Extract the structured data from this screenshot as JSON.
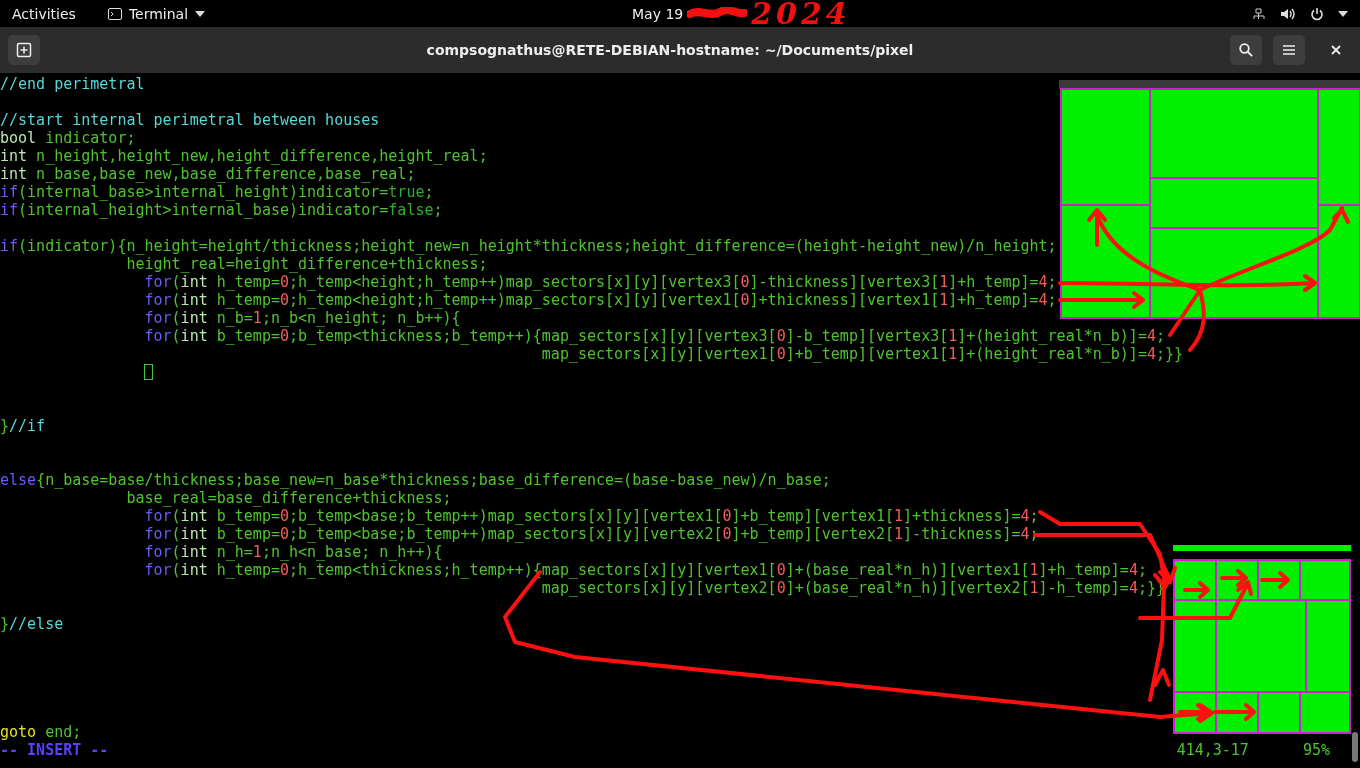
{
  "top_bar": {
    "activities": "Activities",
    "app_menu": "Terminal",
    "date": "May 19",
    "handwritten_year": "2024"
  },
  "window": {
    "title": "compsognathus@RETE-DEBIAN-hostname: ~/Documents/pixel"
  },
  "editor": {
    "lines": [
      {
        "kind": "code",
        "segments": [
          {
            "kind": "comment",
            "text": "//end perimetral"
          }
        ]
      },
      {
        "kind": "blank"
      },
      {
        "kind": "code",
        "segments": [
          {
            "kind": "comment",
            "text": "//start internal perimetral between houses"
          }
        ]
      },
      {
        "kind": "code",
        "segments": [
          {
            "kind": "type",
            "text": "bool"
          },
          {
            "kind": "plain",
            "text": " indicator;"
          }
        ]
      },
      {
        "kind": "code",
        "segments": [
          {
            "kind": "type",
            "text": "int"
          },
          {
            "kind": "plain",
            "text": " n_height,height_new,height_difference,height_real;"
          }
        ]
      },
      {
        "kind": "code",
        "segments": [
          {
            "kind": "type",
            "text": "int"
          },
          {
            "kind": "plain",
            "text": " n_base,base_new,base_difference,base_real;"
          }
        ]
      },
      {
        "kind": "code",
        "segments": [
          {
            "kind": "keyword",
            "text": "if"
          },
          {
            "kind": "plain",
            "text": "(internal_base>internal_height)indicator="
          },
          {
            "kind": "constant",
            "text": "true"
          },
          {
            "kind": "plain",
            "text": ";"
          }
        ]
      },
      {
        "kind": "code",
        "segments": [
          {
            "kind": "keyword",
            "text": "if"
          },
          {
            "kind": "plain",
            "text": "(internal_height>internal_base)indicator="
          },
          {
            "kind": "constant",
            "text": "false"
          },
          {
            "kind": "plain",
            "text": ";"
          }
        ]
      },
      {
        "kind": "blank"
      },
      {
        "kind": "code",
        "segments": [
          {
            "kind": "keyword",
            "text": "if"
          },
          {
            "kind": "plain",
            "text": "(indicator){n_height=height/thickness;height_new=n_height*thickness;height_difference=(height-height_new)/n_height;"
          }
        ]
      },
      {
        "kind": "statement",
        "segments": [
          {
            "kind": "plain",
            "text": "height_real=height_difference+thickness;"
          }
        ]
      },
      {
        "kind": "loop",
        "segments": [
          {
            "kind": "keyword",
            "text": "for"
          },
          {
            "kind": "plain",
            "text": "("
          },
          {
            "kind": "type",
            "text": "int"
          },
          {
            "kind": "plain",
            "text": " h_temp="
          },
          {
            "kind": "number",
            "text": "0"
          },
          {
            "kind": "plain",
            "text": ";h_temp<height;h_temp++)map_sectors[x][y][vertex3["
          },
          {
            "kind": "number",
            "text": "0"
          },
          {
            "kind": "plain",
            "text": "]-thickness][vertex3["
          },
          {
            "kind": "number",
            "text": "1"
          },
          {
            "kind": "plain",
            "text": "]+h_temp]="
          },
          {
            "kind": "number",
            "text": "4"
          },
          {
            "kind": "plain",
            "text": ";"
          }
        ]
      },
      {
        "kind": "loop",
        "segments": [
          {
            "kind": "keyword",
            "text": "for"
          },
          {
            "kind": "plain",
            "text": "("
          },
          {
            "kind": "type",
            "text": "int"
          },
          {
            "kind": "plain",
            "text": " h_temp="
          },
          {
            "kind": "number",
            "text": "0"
          },
          {
            "kind": "plain",
            "text": ";h_temp<height;h_temp++)map_sectors[x][y][vertex1["
          },
          {
            "kind": "number",
            "text": "0"
          },
          {
            "kind": "plain",
            "text": "]+thickness][vertex1["
          },
          {
            "kind": "number",
            "text": "1"
          },
          {
            "kind": "plain",
            "text": "]+h_temp]="
          },
          {
            "kind": "number",
            "text": "4"
          },
          {
            "kind": "plain",
            "text": ";"
          }
        ]
      },
      {
        "kind": "loop",
        "segments": [
          {
            "kind": "keyword",
            "text": "for"
          },
          {
            "kind": "plain",
            "text": "("
          },
          {
            "kind": "type",
            "text": "int"
          },
          {
            "kind": "plain",
            "text": " n_b="
          },
          {
            "kind": "number",
            "text": "1"
          },
          {
            "kind": "plain",
            "text": ";n_b<n_height; n_b++){"
          }
        ]
      },
      {
        "kind": "loop",
        "segments": [
          {
            "kind": "keyword",
            "text": "for"
          },
          {
            "kind": "plain",
            "text": "("
          },
          {
            "kind": "type",
            "text": "int"
          },
          {
            "kind": "plain",
            "text": " b_temp="
          },
          {
            "kind": "number",
            "text": "0"
          },
          {
            "kind": "plain",
            "text": ";b_temp<thickness;b_temp++){map_sectors[x][y][vertex3["
          },
          {
            "kind": "number",
            "text": "0"
          },
          {
            "kind": "plain",
            "text": "]-b_temp][vertex3["
          },
          {
            "kind": "number",
            "text": "1"
          },
          {
            "kind": "plain",
            "text": "]+(height_real*n_b)]="
          },
          {
            "kind": "number",
            "text": "4"
          },
          {
            "kind": "plain",
            "text": ";"
          }
        ]
      },
      {
        "kind": "continuation",
        "segments": [
          {
            "kind": "plain",
            "text": "map_sectors[x][y][vertex1["
          },
          {
            "kind": "number",
            "text": "0"
          },
          {
            "kind": "plain",
            "text": "]+b_temp][vertex1["
          },
          {
            "kind": "number",
            "text": "1"
          },
          {
            "kind": "plain",
            "text": "]+(height_real*n_b)]="
          },
          {
            "kind": "number",
            "text": "4"
          },
          {
            "kind": "plain",
            "text": ";}}"
          }
        ]
      },
      {
        "kind": "cursor"
      },
      {
        "kind": "blank"
      },
      {
        "kind": "blank"
      },
      {
        "kind": "code",
        "segments": [
          {
            "kind": "plain",
            "text": "}"
          },
          {
            "kind": "comment",
            "text": "//if"
          }
        ]
      },
      {
        "kind": "blank"
      },
      {
        "kind": "blank"
      },
      {
        "kind": "code",
        "segments": [
          {
            "kind": "keyword",
            "text": "else"
          },
          {
            "kind": "plain",
            "text": "{n_base=base/thickness;base_new=n_base*thickness;base_difference=(base-base_new)/n_base;"
          }
        ]
      },
      {
        "kind": "statement",
        "segments": [
          {
            "kind": "plain",
            "text": "base_real=base_difference+thickness;"
          }
        ]
      },
      {
        "kind": "loop",
        "segments": [
          {
            "kind": "keyword",
            "text": "for"
          },
          {
            "kind": "plain",
            "text": "("
          },
          {
            "kind": "type",
            "text": "int"
          },
          {
            "kind": "plain",
            "text": " b_temp="
          },
          {
            "kind": "number",
            "text": "0"
          },
          {
            "kind": "plain",
            "text": ";b_temp<base;b_temp++)map_sectors[x][y][vertex1["
          },
          {
            "kind": "number",
            "text": "0"
          },
          {
            "kind": "plain",
            "text": "]+b_temp][vertex1["
          },
          {
            "kind": "number",
            "text": "1"
          },
          {
            "kind": "plain",
            "text": "]+thickness]="
          },
          {
            "kind": "number",
            "text": "4"
          },
          {
            "kind": "plain",
            "text": ";"
          }
        ]
      },
      {
        "kind": "loop",
        "segments": [
          {
            "kind": "keyword",
            "text": "for"
          },
          {
            "kind": "plain",
            "text": "("
          },
          {
            "kind": "type",
            "text": "int"
          },
          {
            "kind": "plain",
            "text": " b_temp="
          },
          {
            "kind": "number",
            "text": "0"
          },
          {
            "kind": "plain",
            "text": ";b_temp<base;b_temp++)map_sectors[x][y][vertex2["
          },
          {
            "kind": "number",
            "text": "0"
          },
          {
            "kind": "plain",
            "text": "]+b_temp][vertex2["
          },
          {
            "kind": "number",
            "text": "1"
          },
          {
            "kind": "plain",
            "text": "]-thickness]="
          },
          {
            "kind": "number",
            "text": "4"
          },
          {
            "kind": "plain",
            "text": ";"
          }
        ]
      },
      {
        "kind": "loop",
        "segments": [
          {
            "kind": "keyword",
            "text": "for"
          },
          {
            "kind": "plain",
            "text": "("
          },
          {
            "kind": "type",
            "text": "int"
          },
          {
            "kind": "plain",
            "text": " n_h="
          },
          {
            "kind": "number",
            "text": "1"
          },
          {
            "kind": "plain",
            "text": ";n_h<n_base; n_h++){"
          }
        ]
      },
      {
        "kind": "loop",
        "segments": [
          {
            "kind": "keyword",
            "text": "for"
          },
          {
            "kind": "plain",
            "text": "("
          },
          {
            "kind": "type",
            "text": "int"
          },
          {
            "kind": "plain",
            "text": " h_temp="
          },
          {
            "kind": "number",
            "text": "0"
          },
          {
            "kind": "plain",
            "text": ";h_temp<thickness;h_temp++){map_sectors[x][y][vertex1["
          },
          {
            "kind": "number",
            "text": "0"
          },
          {
            "kind": "plain",
            "text": "]+(base_real*n_h)][vertex1["
          },
          {
            "kind": "number",
            "text": "1"
          },
          {
            "kind": "plain",
            "text": "]+h_temp]="
          },
          {
            "kind": "number",
            "text": "4"
          },
          {
            "kind": "plain",
            "text": ";"
          }
        ]
      },
      {
        "kind": "continuation",
        "segments": [
          {
            "kind": "plain",
            "text": "map_sectors[x][y][vertex2["
          },
          {
            "kind": "number",
            "text": "0"
          },
          {
            "kind": "plain",
            "text": "]+(base_real*n_h)][vertex2["
          },
          {
            "kind": "number",
            "text": "1"
          },
          {
            "kind": "plain",
            "text": "]-h_temp]="
          },
          {
            "kind": "number",
            "text": "4"
          },
          {
            "kind": "plain",
            "text": ";}}"
          }
        ]
      },
      {
        "kind": "blank"
      },
      {
        "kind": "code",
        "segments": [
          {
            "kind": "plain",
            "text": "}"
          },
          {
            "kind": "comment",
            "text": "//else"
          }
        ]
      },
      {
        "kind": "blank"
      },
      {
        "kind": "blank"
      },
      {
        "kind": "blank"
      },
      {
        "kind": "blank"
      },
      {
        "kind": "blank"
      },
      {
        "kind": "code",
        "segments": [
          {
            "kind": "label",
            "text": "goto"
          },
          {
            "kind": "plain",
            "text": " end;"
          }
        ]
      }
    ],
    "status": {
      "mode": "-- INSERT --",
      "position": "414,3-17",
      "scroll": "95%"
    }
  }
}
